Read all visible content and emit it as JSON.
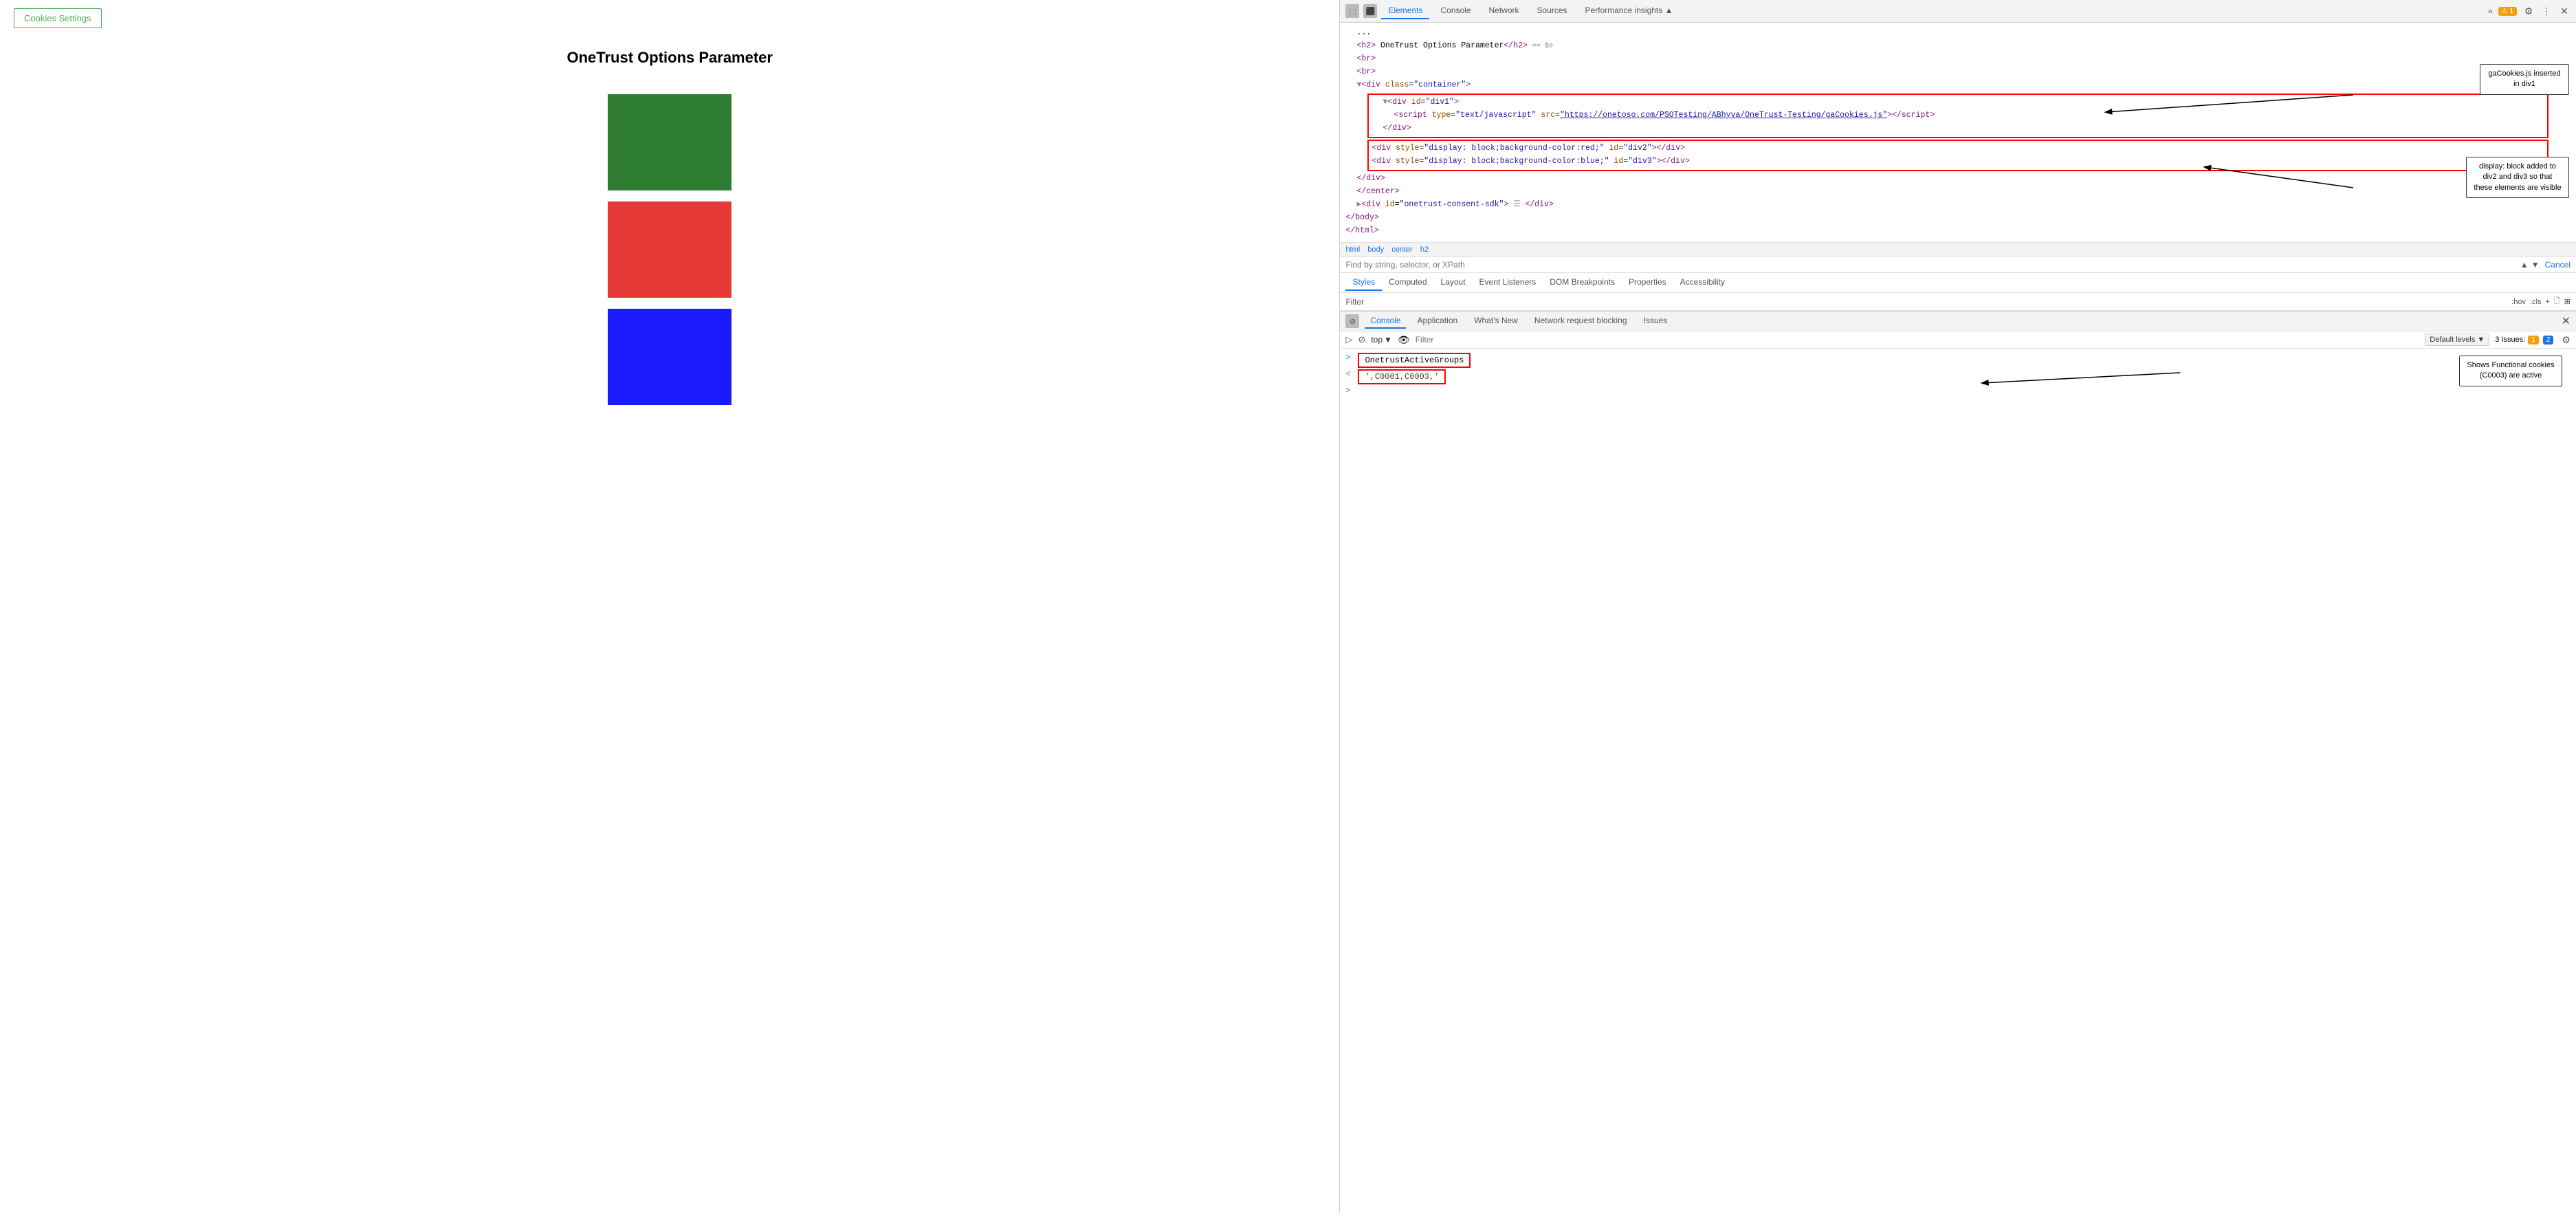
{
  "left": {
    "cookies_button": "Cookies Settings",
    "page_title": "OneTrust Options Parameter",
    "blocks": [
      {
        "color": "#2e7d32",
        "name": "green-block"
      },
      {
        "color": "#e53935",
        "name": "red-block"
      },
      {
        "color": "#1a1aff",
        "name": "blue-block"
      }
    ]
  },
  "devtools": {
    "tabs": [
      "Elements",
      "Console",
      "Network",
      "Sources",
      "Performance insights ▲"
    ],
    "active_tab": "Elements",
    "toolbar_icons": [
      "cursor-icon",
      "inspect-icon"
    ],
    "badge_count": "1",
    "elements_html": {
      "lines": [
        {
          "indent": 1,
          "content": "<h2> OneTrust Options Parameter</h2>",
          "extra": "== $0"
        },
        {
          "indent": 1,
          "content": "<br>"
        },
        {
          "indent": 1,
          "content": "<br>"
        },
        {
          "indent": 1,
          "content": "▼<div class=\"container\">"
        },
        {
          "indent": 2,
          "content": "▼<div id=\"div1\">"
        },
        {
          "indent": 3,
          "content": "<script type=\"text/javascript\" src=\"https://onetoso.com/PSOTesting/ABhyva/OneTrust-Testing/gaCookies.js\"><\\/script>"
        },
        {
          "indent": 2,
          "content": "</div>"
        },
        {
          "indent": 2,
          "content": "<div style=\"display: block;background-color:red;\" id=\"div2\"></div>"
        },
        {
          "indent": 2,
          "content": "<div style=\"display: block;background-color:blue;\" id=\"div3\"></div>"
        },
        {
          "indent": 1,
          "content": "</div>"
        },
        {
          "indent": 1,
          "content": "</center>"
        },
        {
          "indent": 1,
          "content": "▶<div id=\"onetrust-consent-sdk\"> ☰ </div>"
        },
        {
          "indent": 0,
          "content": "</body>"
        },
        {
          "indent": 0,
          "content": "</html>"
        }
      ]
    },
    "callout1": {
      "text": "gaCookies.js\ninserted in div1"
    },
    "callout2": {
      "text": "display: block\nadded to div2 and\ndiv3 so that these\nelements are visible"
    },
    "breadcrumbs": [
      "html",
      "body",
      "center",
      "h2"
    ],
    "find_placeholder": "Find by string, selector, or XPath",
    "find_cancel": "Cancel",
    "styles_tabs": [
      "Styles",
      "Computed",
      "Layout",
      "Event Listeners",
      "DOM Breakpoints",
      "Properties",
      "Accessibility"
    ],
    "active_styles_tab": "Styles",
    "filter_label": "Filter",
    "filter_right": ":hov  .cls  +",
    "console": {
      "tabs": [
        "Console",
        "Application",
        "What's New",
        "Network request blocking",
        "Issues"
      ],
      "active_tab": "Console",
      "top_label": "top",
      "filter_placeholder": "Filter",
      "default_levels": "Default levels ▼",
      "issues_count": "3 Issues:",
      "issues_badge1": "1",
      "issues_badge2": "2",
      "output_lines": [
        {
          "type": "command",
          "text": "OnetrustActiveGroups"
        },
        {
          "type": "result",
          "text": "',C0001,C0003,'"
        }
      ],
      "callout3": {
        "text": "Shows Functional\ncookies (C0003)\nare active"
      }
    }
  }
}
